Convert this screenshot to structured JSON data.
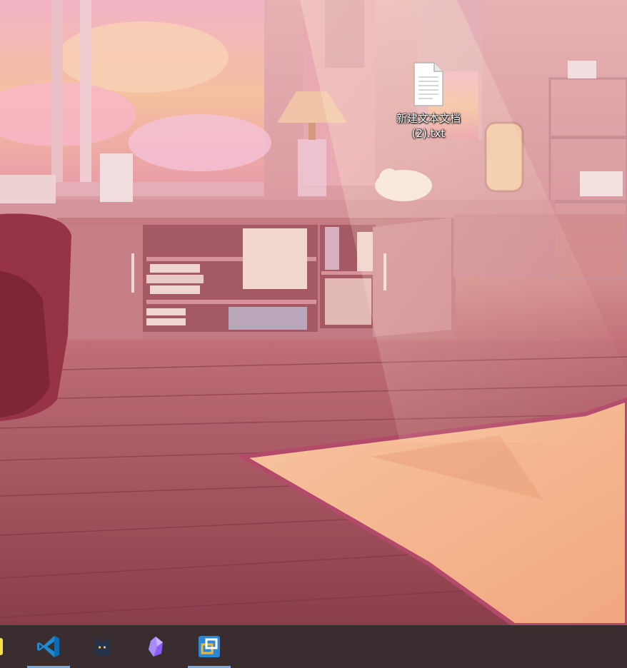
{
  "desktop": {
    "icons": [
      {
        "label": "新建文本文档 (2).txt",
        "type": "text-file"
      }
    ]
  },
  "taskbar": {
    "apps": [
      {
        "name": "partial-app-icon",
        "active": false
      },
      {
        "name": "vscode-icon",
        "active": true
      },
      {
        "name": "cat-icon",
        "active": false
      },
      {
        "name": "crystal-icon",
        "active": false
      },
      {
        "name": "remote-desktop-icon",
        "active": true
      }
    ]
  }
}
